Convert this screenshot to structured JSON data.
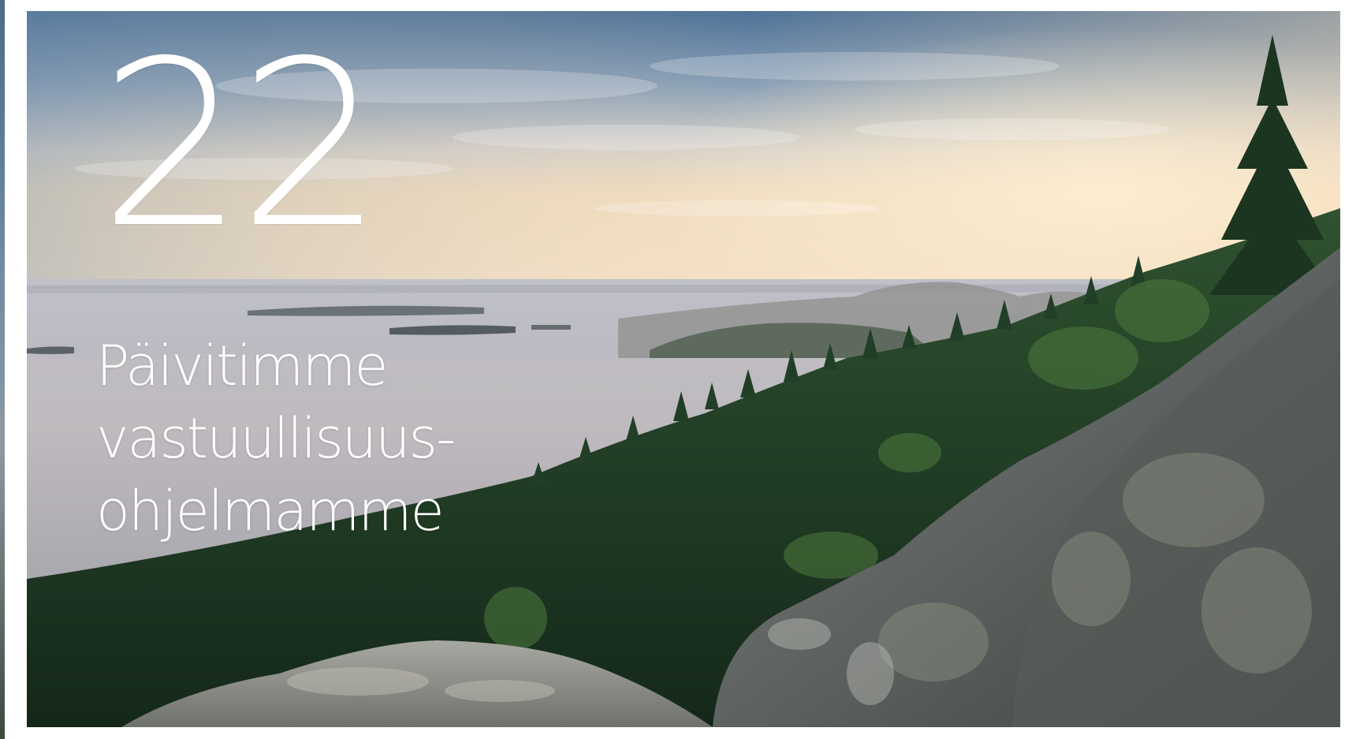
{
  "hero": {
    "number": "22",
    "title_lines": [
      "Päivitimme",
      "vastuullisuus-",
      "ohjelmamme"
    ]
  },
  "colors": {
    "text": "#ffffff",
    "sky_top": "#5e7ea0",
    "sky_horizon": "#f3d9b8",
    "lake": "#c7c4c9",
    "forest": "#1f3b25",
    "rock": "#6c706e"
  },
  "icons": {
    "scene": "lake-forest-rock-landscape"
  }
}
